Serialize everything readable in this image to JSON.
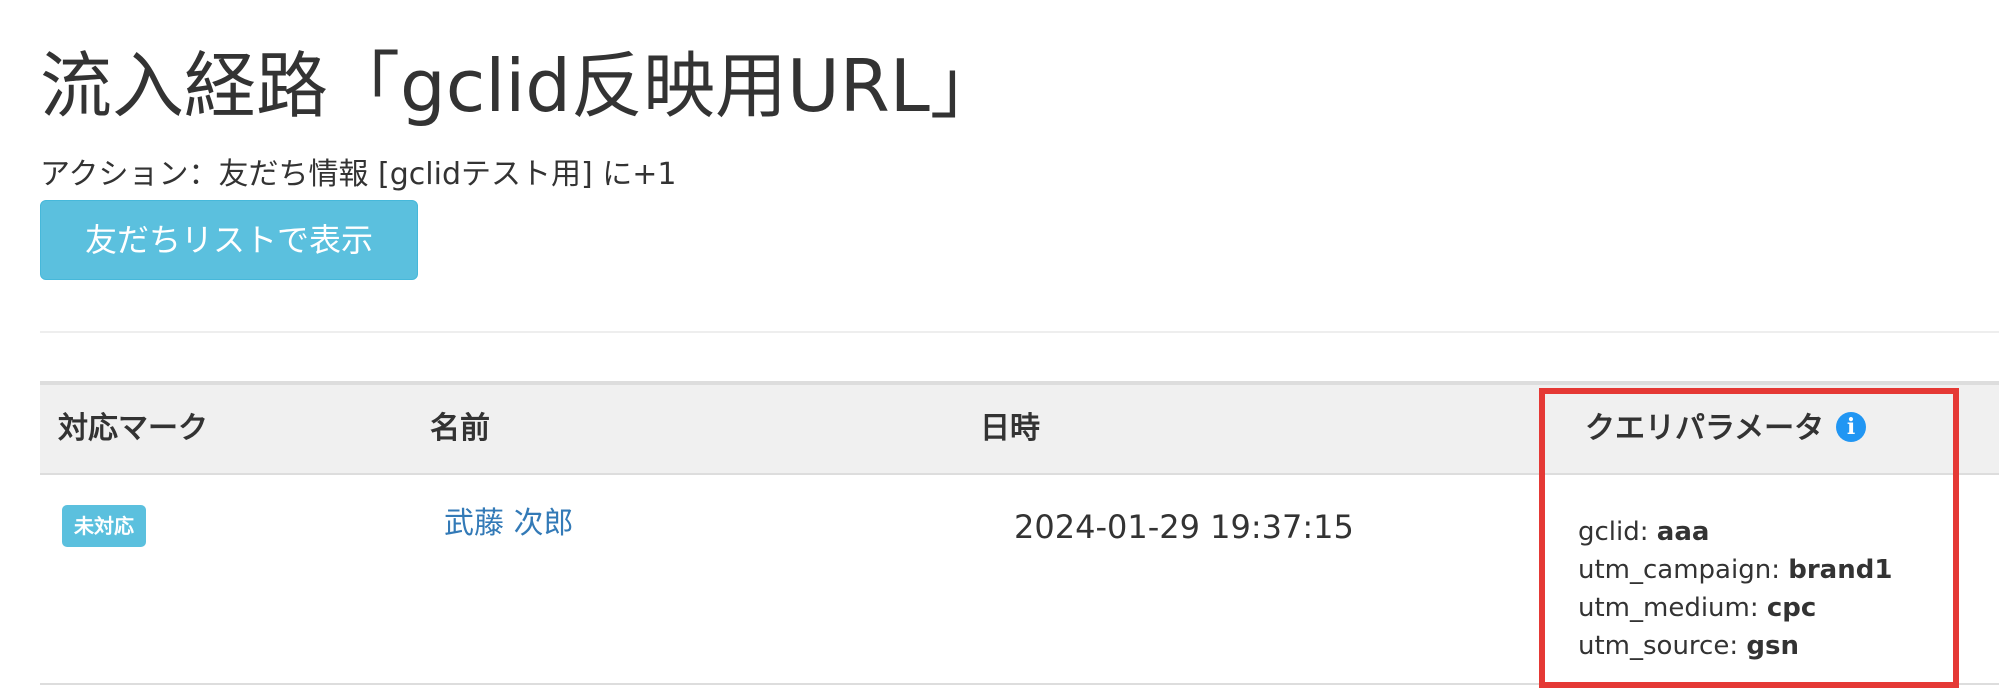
{
  "page": {
    "title": "流入経路「gclid反映用URL」",
    "action_text": "アクション：友だち情報 [gclidテスト用] に+1",
    "friends_button_label": "友だちリストで表示"
  },
  "table": {
    "headers": {
      "mark": "対応マーク",
      "name": "名前",
      "datetime": "日時",
      "query_params": "クエリパラメータ"
    },
    "info_icon": "info-icon",
    "rows": [
      {
        "status": "未対応",
        "name": "武藤 次郎",
        "datetime": "2024-01-29 19:37:15",
        "params": [
          {
            "key": "gclid:",
            "value": "aaa"
          },
          {
            "key": "utm_campaign:",
            "value": "brand1"
          },
          {
            "key": "utm_medium:",
            "value": "cpc"
          },
          {
            "key": "utm_source:",
            "value": "gsn"
          }
        ]
      }
    ]
  },
  "colors": {
    "button": "#5bc0de",
    "link": "#337ab7",
    "highlight": "#e53935",
    "info_icon": "#2196f3"
  }
}
